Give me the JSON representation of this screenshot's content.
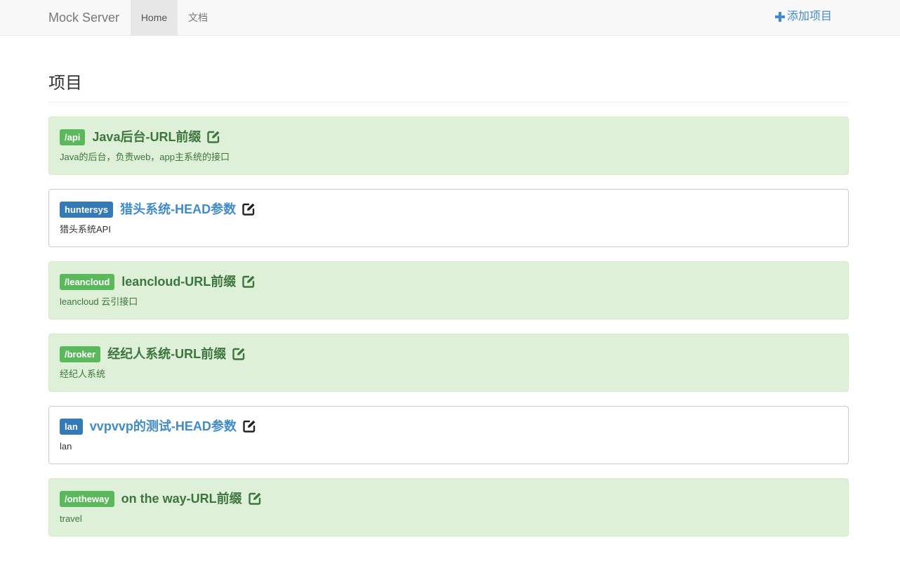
{
  "navbar": {
    "brand": "Mock Server",
    "items": [
      {
        "label": "Home",
        "active": true
      },
      {
        "label": "文档",
        "active": false
      }
    ],
    "add_label": "添加项目",
    "add_icon": "plus-icon"
  },
  "page": {
    "title": "项目"
  },
  "projects": [
    {
      "tag": "/api",
      "title": "Java后台-URL前缀",
      "desc": "Java的后台，负责web，app主系统的接口",
      "style": "success"
    },
    {
      "tag": "huntersys",
      "title": "猎头系统-HEAD参数",
      "desc": "猎头系统API",
      "style": "default"
    },
    {
      "tag": "/leancloud",
      "title": "leancloud-URL前缀",
      "desc": "leancloud 云引接口",
      "style": "success"
    },
    {
      "tag": "/broker",
      "title": "经纪人系统-URL前缀",
      "desc": "经纪人系统",
      "style": "success"
    },
    {
      "tag": "lan",
      "title": "vvpvvp的测试-HEAD参数",
      "desc": "lan",
      "style": "default"
    },
    {
      "tag": "/ontheway",
      "title": "on the way-URL前缀",
      "desc": "travel",
      "style": "success"
    }
  ],
  "colors": {
    "success_bg": "#dff0d8",
    "success_text": "#3c763d",
    "success_label": "#5cb85c",
    "primary_label": "#337ab7",
    "link": "#428bca"
  }
}
